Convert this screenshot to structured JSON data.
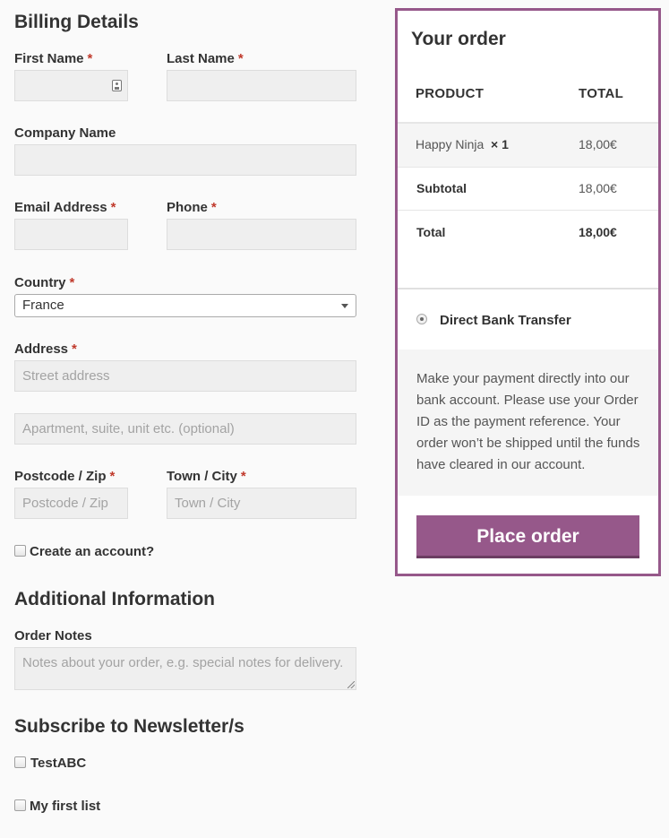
{
  "billing": {
    "heading": "Billing Details",
    "first_name_label": "First Name",
    "last_name_label": "Last Name",
    "company_label": "Company Name",
    "email_label": "Email Address",
    "phone_label": "Phone",
    "country_label": "Country",
    "country_value": "France",
    "address_label": "Address",
    "street_placeholder": "Street address",
    "apartment_placeholder": "Apartment, suite, unit etc. (optional)",
    "postcode_label": "Postcode / Zip",
    "postcode_placeholder": "Postcode / Zip",
    "town_label": "Town / City",
    "town_placeholder": "Town / City",
    "required_mark": "*",
    "create_account_label": "Create an account?"
  },
  "additional": {
    "heading": "Additional Information",
    "notes_label": "Order Notes",
    "notes_placeholder": "Notes about your order, e.g. special notes for delivery."
  },
  "newsletter": {
    "heading": "Subscribe to Newsletter/s",
    "lists": [
      "TestABC",
      "My first list"
    ]
  },
  "order": {
    "title": "Your order",
    "col_product": "PRODUCT",
    "col_total": "TOTAL",
    "item_name": "Happy Ninja",
    "item_qty": "× 1",
    "item_total": "18,00€",
    "subtotal_label": "Subtotal",
    "subtotal_value": "18,00€",
    "total_label": "Total",
    "total_value": "18,00€",
    "payment_method": "Direct Bank Transfer",
    "payment_description": "Make your payment directly into our bank account. Please use your Order ID as the payment reference. Your order won’t be shipped until the funds have cleared in our account.",
    "place_order_label": "Place order"
  },
  "colors": {
    "accent": "#96588a",
    "required": "#c0392b"
  },
  "icons": {
    "first_name_field_icon": "contact-card-icon",
    "country_dropdown_icon": "caret-down-icon"
  }
}
